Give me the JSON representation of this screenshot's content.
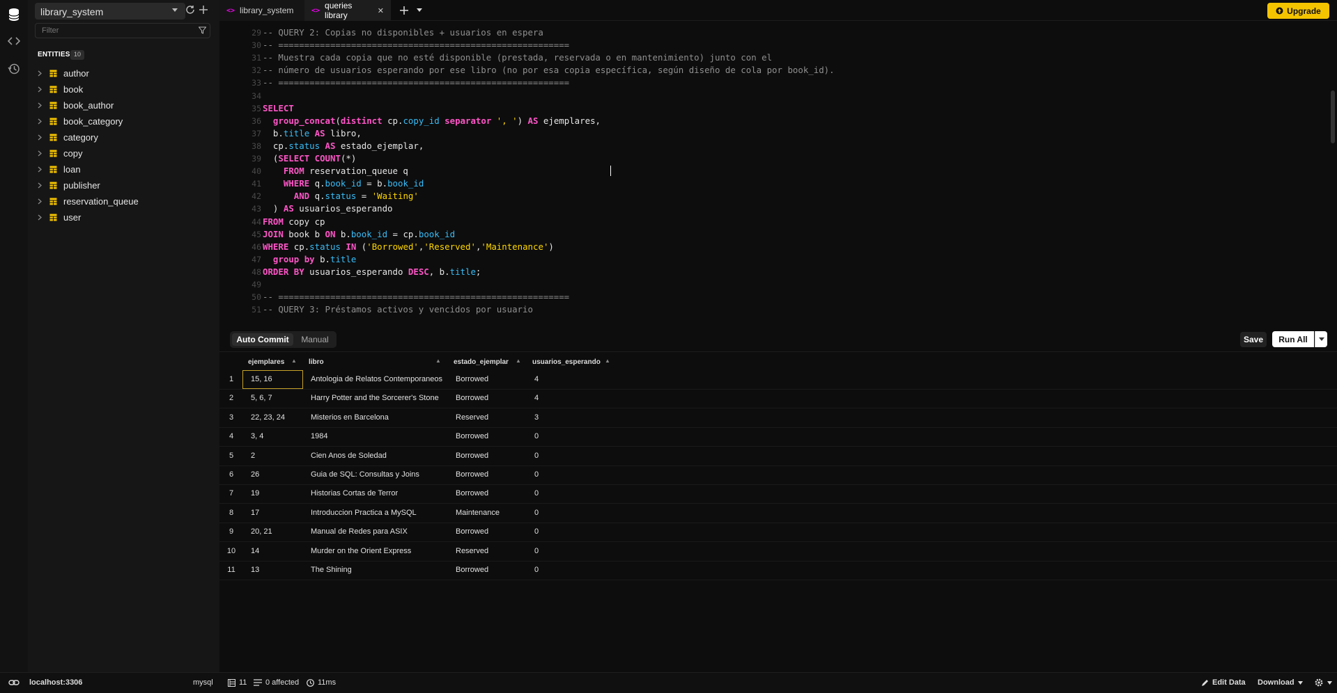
{
  "sidebar": {
    "database": "library_system",
    "filter_placeholder": "Filter",
    "entities_title": "ENTITIES",
    "entities_count": "10",
    "entities": [
      "author",
      "book",
      "book_author",
      "book_category",
      "category",
      "copy",
      "loan",
      "publisher",
      "reservation_queue",
      "user"
    ]
  },
  "tabs": [
    {
      "label": "library_system"
    },
    {
      "label": "queries library"
    }
  ],
  "upgrade_label": "Upgrade",
  "editor": {
    "line_numbers": [
      "29",
      "30",
      "31",
      "32",
      "33",
      "34",
      "35",
      "36",
      "37",
      "38",
      "39",
      "40",
      "41",
      "42",
      "43",
      "44",
      "45",
      "46",
      "47",
      "48",
      "49",
      "50",
      "51"
    ],
    "lines": [
      "-- QUERY 2: Copias no disponibles + usuarios en espera",
      "-- ========================================================",
      "-- Muestra cada copia que no esté disponible (prestada, reservada o en mantenimiento) junto con el",
      "-- número de usuarios esperando por ese libro (no por esa copia específica, según diseño de cola por book_id).",
      "-- ========================================================",
      "",
      "SELECT",
      "  group_concat(distinct cp.copy_id separator ', ') AS ejemplares,",
      "  b.title AS libro,",
      "  cp.status AS estado_ejemplar,",
      "  (SELECT COUNT(*)",
      "    FROM reservation_queue q",
      "    WHERE q.book_id = b.book_id",
      "      AND q.status = 'Waiting'",
      "  ) AS usuarios_esperando",
      "FROM copy cp",
      "JOIN book b ON b.book_id = cp.book_id",
      "WHERE cp.status IN ('Borrowed','Reserved','Maintenance')",
      "  group by b.title",
      "ORDER BY usuarios_esperando DESC, b.title;",
      "",
      "-- ========================================================",
      "-- QUERY 3: Préstamos activos y vencidos por usuario"
    ]
  },
  "results_toolbar": {
    "auto_commit": "Auto Commit",
    "manual": "Manual",
    "save": "Save",
    "run_all": "Run All"
  },
  "results": {
    "columns": [
      "ejemplares",
      "libro",
      "estado_ejemplar",
      "usuarios_esperando"
    ],
    "rows": [
      [
        "1",
        "15, 16",
        "Antologia de Relatos Contemporaneos",
        "Borrowed",
        "4"
      ],
      [
        "2",
        "5, 6, 7",
        "Harry Potter and the Sorcerer's Stone",
        "Borrowed",
        "4"
      ],
      [
        "3",
        "22, 23, 24",
        "Misterios en Barcelona",
        "Reserved",
        "3"
      ],
      [
        "4",
        "3, 4",
        "1984",
        "Borrowed",
        "0"
      ],
      [
        "5",
        "2",
        "Cien Anos de Soledad",
        "Borrowed",
        "0"
      ],
      [
        "6",
        "26",
        "Guia de SQL: Consultas y Joins",
        "Borrowed",
        "0"
      ],
      [
        "7",
        "19",
        "Historias Cortas de Terror",
        "Borrowed",
        "0"
      ],
      [
        "8",
        "17",
        "Introduccion Practica a MySQL",
        "Maintenance",
        "0"
      ],
      [
        "9",
        "20, 21",
        "Manual de Redes para ASIX",
        "Borrowed",
        "0"
      ],
      [
        "10",
        "14",
        "Murder on the Orient Express",
        "Reserved",
        "0"
      ],
      [
        "11",
        "13",
        "The Shining",
        "Borrowed",
        "0"
      ]
    ]
  },
  "statusbar": {
    "connection": "localhost:3306",
    "engine": "mysql",
    "rows": "11",
    "affected": "0 affected",
    "time": "11ms",
    "edit_data": "Edit Data",
    "download": "Download"
  },
  "colors": {
    "accent": "#f5c400",
    "keyword": "#ff55c8",
    "field": "#38bdf8",
    "string": "#ffd700",
    "comment": "#8f8f8f"
  }
}
